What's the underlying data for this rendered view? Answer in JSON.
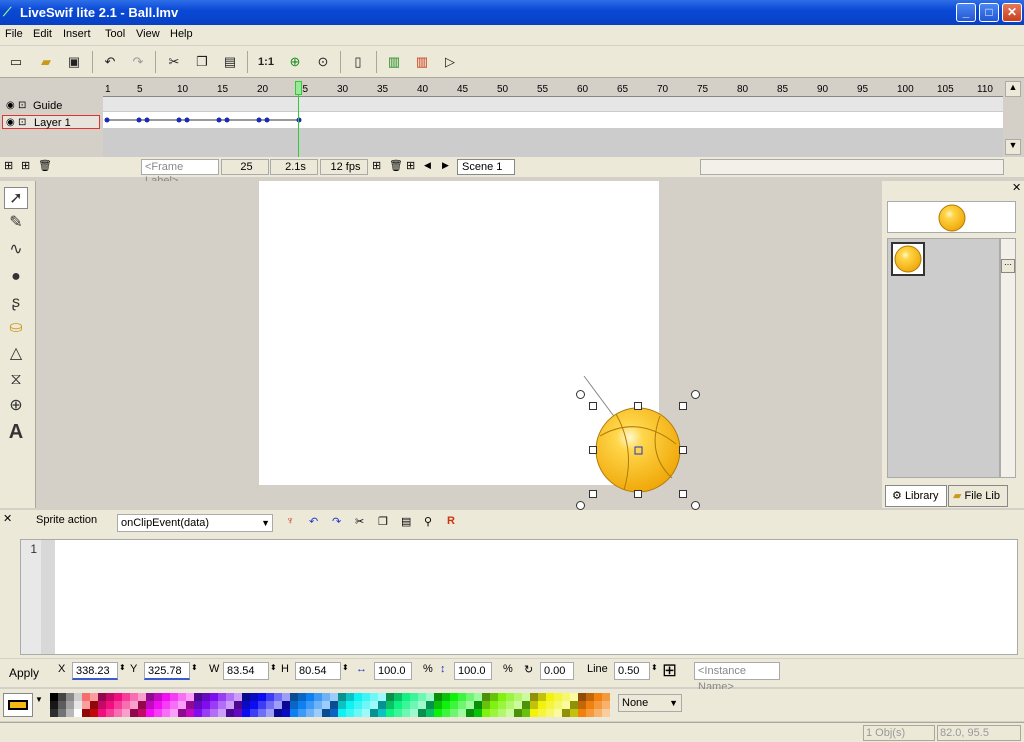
{
  "window": {
    "title": "LiveSwif lite 2.1  - Ball.lmv"
  },
  "menu": [
    "File",
    "Edit",
    "Insert",
    "Tool",
    "View",
    "Help"
  ],
  "toolbar": {
    "zoom_label": "1:1"
  },
  "timeline": {
    "layers": [
      {
        "name": "Guide"
      },
      {
        "name": "Layer 1"
      }
    ],
    "ruler_ticks": [
      "1",
      "5",
      "10",
      "15",
      "20",
      "25",
      "30",
      "35",
      "40",
      "45",
      "50",
      "55",
      "60",
      "65",
      "70",
      "75",
      "80",
      "85",
      "90",
      "95",
      "100",
      "105",
      "110"
    ],
    "frame_label_placeholder": "<Frame Label>",
    "current_frame": "25",
    "time": "2.1s",
    "fps": "12 fps",
    "scene": "Scene 1"
  },
  "library": {
    "tabs": [
      "Library",
      "File Lib"
    ]
  },
  "actions": {
    "label": "Sprite action",
    "event": "onClipEvent(data)",
    "line_number": "1"
  },
  "properties": {
    "apply": "Apply",
    "x_label": "X",
    "x": "338.23",
    "y_label": "Y",
    "y": "325.78",
    "w_label": "W",
    "w": "83.54",
    "h_label": "H",
    "h": "80.54",
    "scale_x": "100.0",
    "pct1": "%",
    "scale_y": "100.0",
    "pct2": "%",
    "rotation": "0.00",
    "line_label": "Line",
    "line": "0.50",
    "instance_placeholder": "<Instance Name>"
  },
  "palette": {
    "fill_select": "None"
  },
  "status": {
    "objects": "1 Obj(s)",
    "coords": "82.0, 95.5"
  },
  "colors": {
    "title_bar": "#0a49d6",
    "ball": "#f5b915",
    "playhead": "#2fcc2f"
  }
}
